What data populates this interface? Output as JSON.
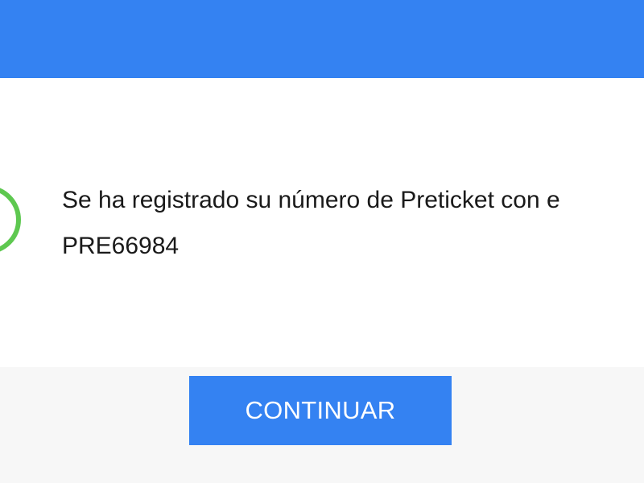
{
  "header": {
    "color": "#3482f2"
  },
  "dialog": {
    "icon": "check-circle-icon",
    "icon_color": "#5ec850",
    "message_line_1": "Se ha registrado su número de Preticket con e",
    "message_line_2": "PRE66984"
  },
  "footer": {
    "continue_label": "CONTINUAR",
    "button_color": "#3482f2"
  }
}
